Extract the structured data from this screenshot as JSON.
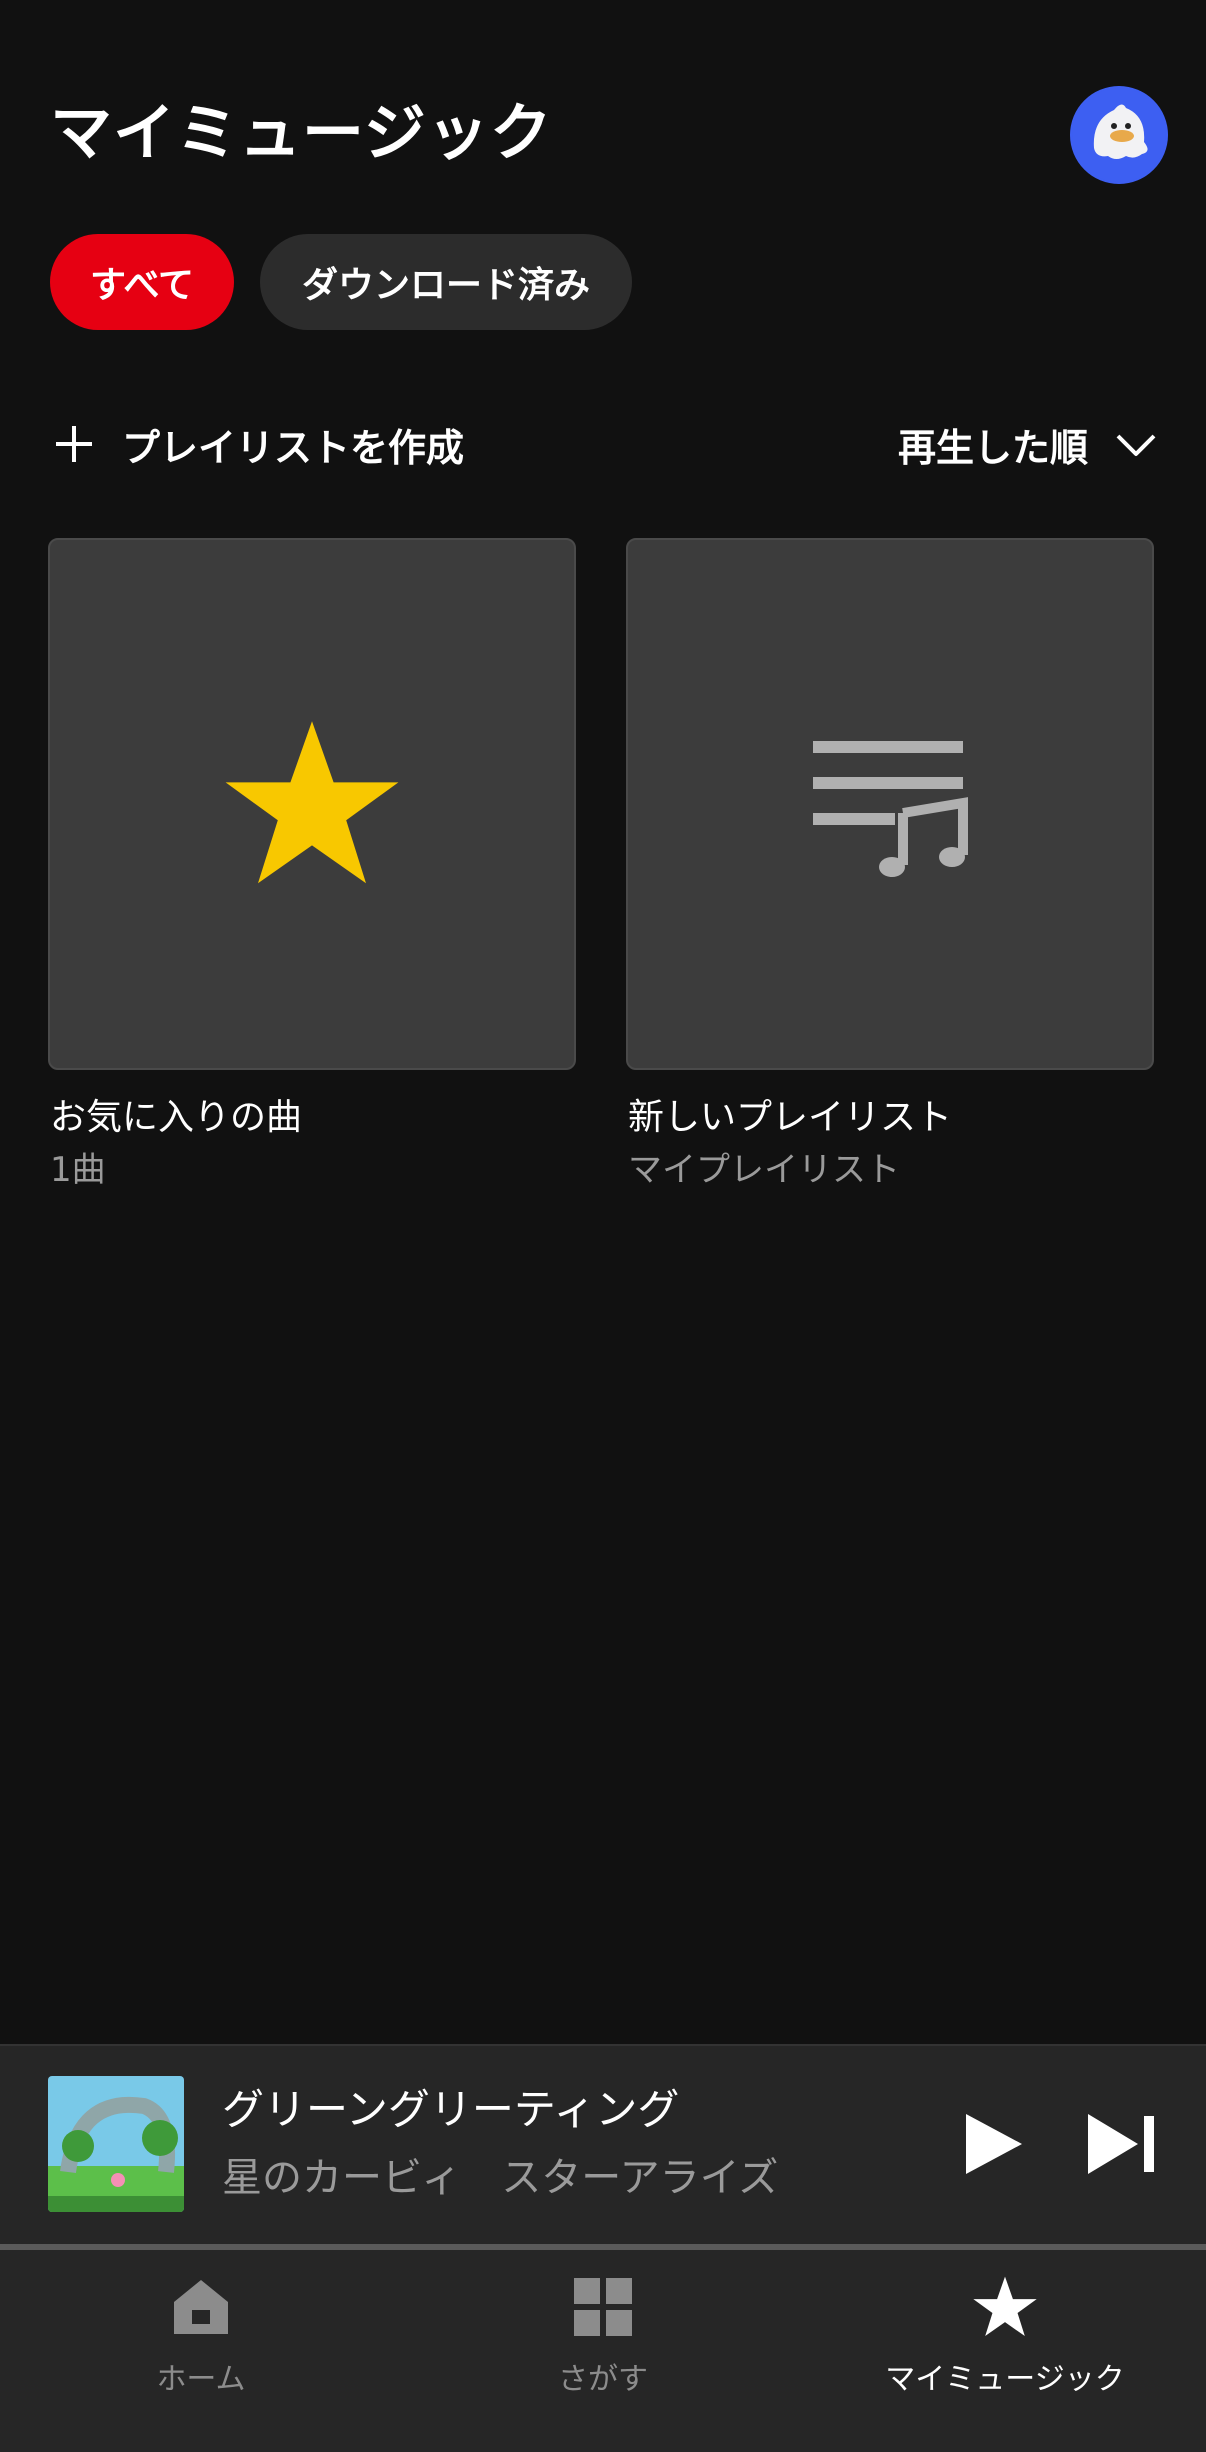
{
  "header": {
    "title": "マイミュージック",
    "avatar_icon": "ghost-avatar-icon"
  },
  "filters": [
    {
      "label": "すべて",
      "selected": true
    },
    {
      "label": "ダウンロード済み",
      "selected": false
    }
  ],
  "actions": {
    "create_playlist_label": "プレイリストを作成",
    "sort_label": "再生した順"
  },
  "cards": [
    {
      "title": "お気に入りの曲",
      "subtitle": "1曲",
      "icon": "star-icon",
      "icon_color": "#f8c800"
    },
    {
      "title": "新しいプレイリスト",
      "subtitle": "マイプレイリスト",
      "icon": "playlist-music-icon",
      "icon_color": "#b0b0b0"
    }
  ],
  "now_playing": {
    "title": "グリーングリーティング",
    "artist": "星のカービィ　スターアライズ",
    "progress": 0
  },
  "bottom_nav": [
    {
      "label": "ホーム",
      "icon": "home-icon",
      "active": false
    },
    {
      "label": "さがす",
      "icon": "grid-icon",
      "active": false
    },
    {
      "label": "マイミュージック",
      "icon": "star-icon",
      "active": true
    }
  ],
  "colors": {
    "accent": "#e60012",
    "background": "#111111",
    "star": "#f8c800"
  }
}
